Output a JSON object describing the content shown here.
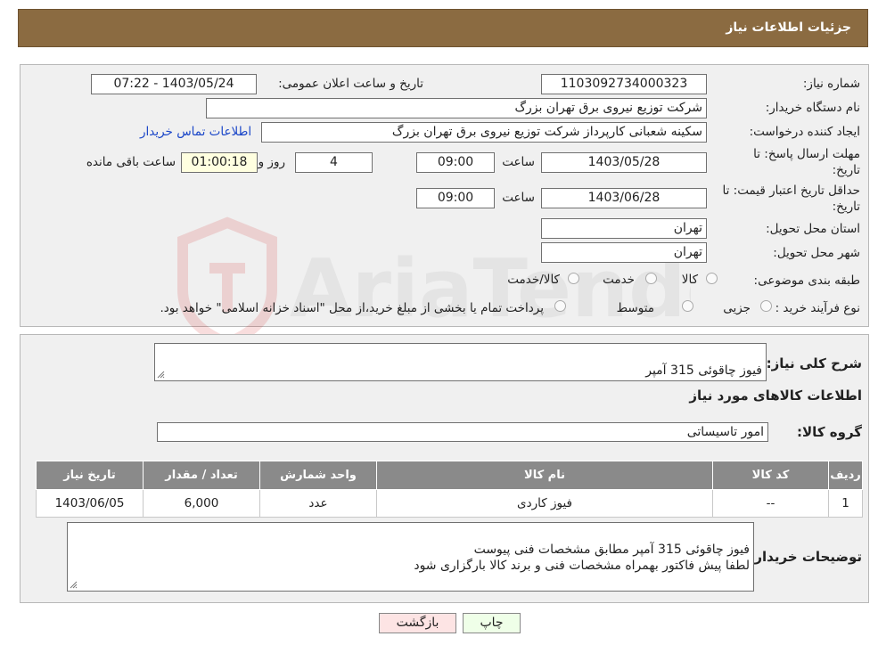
{
  "header": {
    "title": "جزئیات اطلاعات نیاز"
  },
  "form": {
    "need_number_label": "شماره نیاز:",
    "need_number": "1103092734000323",
    "announce_label": "تاریخ و ساعت اعلان عمومی:",
    "announce_value": "1403/05/24 - 07:22",
    "buyer_org_label": "نام دستگاه خریدار:",
    "buyer_org": "شرکت توزیع نیروی برق تهران بزرگ",
    "requester_label": "ایجاد کننده درخواست:",
    "requester": "سکینه شعبانی کارپرداز شرکت توزیع نیروی برق تهران بزرگ",
    "contact_link": "اطلاعات تماس خریدار",
    "deadline_label_1": "مهلت ارسال پاسخ: تا",
    "deadline_label_2": "تاریخ:",
    "deadline_date": "1403/05/28",
    "time_label": "ساعت",
    "deadline_time": "09:00",
    "days_value": "4",
    "days_label": "روز و",
    "remaining_time": "01:00:18",
    "remaining_label": "ساعت باقی مانده",
    "validity_label_1": "حداقل تاریخ اعتبار قیمت: تا",
    "validity_label_2": "تاریخ:",
    "validity_date": "1403/06/28",
    "validity_time": "09:00",
    "province_label": "استان محل تحویل:",
    "province": "تهران",
    "city_label": "شهر محل تحویل:",
    "city": "تهران",
    "category_label": "طبقه بندی موضوعی:",
    "category_options": [
      "کالا",
      "خدمت",
      "کالا/خدمت"
    ],
    "process_label": "نوع فرآیند خرید :",
    "process_options": [
      "جزیی",
      "متوسط"
    ],
    "process_note": "پرداخت تمام یا بخشی از مبلغ خرید،از محل \"اسناد خزانه اسلامی\" خواهد بود."
  },
  "details": {
    "general_desc_label": "شرح کلی نیاز:",
    "general_desc": "فیوز چاقوئی 315 آمپر",
    "goods_info_title": "اطلاعات کالاهای مورد نیاز",
    "goods_group_label": "گروه کالا:",
    "goods_group": "امور تاسیساتی",
    "table": {
      "headers": [
        "ردیف",
        "کد کالا",
        "نام کالا",
        "واحد شمارش",
        "تعداد / مقدار",
        "تاریخ نیاز"
      ],
      "rows": [
        [
          "1",
          "--",
          "فیوز کاردی",
          "عدد",
          "6,000",
          "1403/06/05"
        ]
      ]
    },
    "buyer_notes_label": "توضیحات خریدار:",
    "buyer_notes": "فیوز چاقوئی 315 آمپر مطابق مشخصات فنی پیوست\nلطفا پیش فاکتور بهمراه مشخصات فنی و برند کالا  بارگزاری شود"
  },
  "buttons": {
    "print": "چاپ",
    "back": "بازگشت"
  },
  "watermark": {
    "text": "AriaTender.neT"
  },
  "colors": {
    "header_bg": "#8b6b41",
    "table_header_bg": "#8a8a8a",
    "link": "#1a46c8",
    "back_button_bg": "#fde4e4"
  }
}
